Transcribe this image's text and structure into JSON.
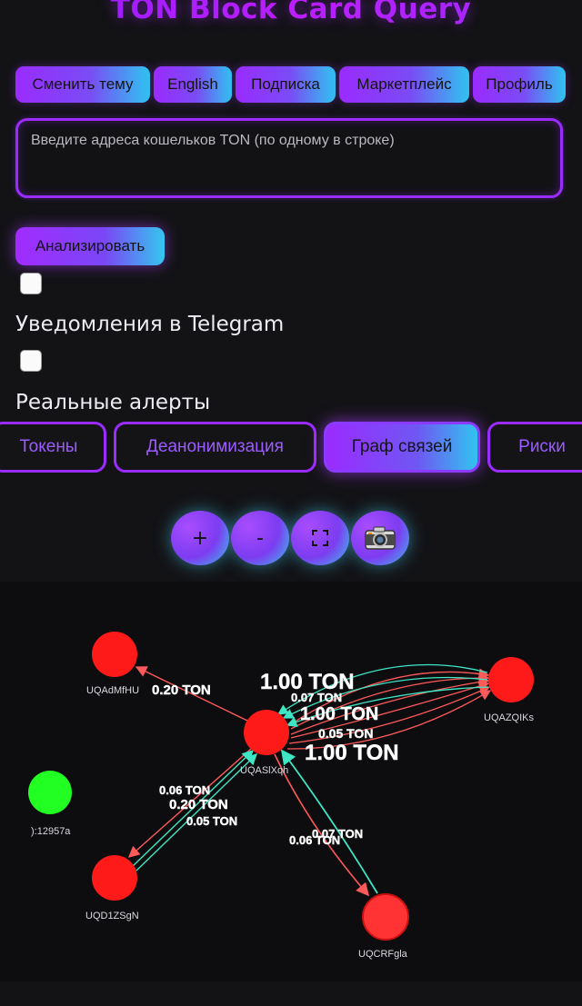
{
  "header": {
    "title": "TON Block Card Query"
  },
  "nav": [
    {
      "label": "Сменить тему"
    },
    {
      "label": "English"
    },
    {
      "label": "Подписка"
    },
    {
      "label": "Маркетплейс"
    },
    {
      "label": "Профиль"
    }
  ],
  "input": {
    "placeholder": "Введите адреса кошельков TON (по одному в строке)",
    "value": ""
  },
  "analyze_label": "Анализировать",
  "options": [
    {
      "label": "Уведомления в Telegram",
      "checked": false
    },
    {
      "label": "Реальные алерты",
      "checked": false
    }
  ],
  "tabs": [
    {
      "label": "Токены",
      "active": false
    },
    {
      "label": "Деанонимизация",
      "active": false
    },
    {
      "label": "Граф связей",
      "active": true
    },
    {
      "label": "Риски",
      "active": false
    }
  ],
  "controls": {
    "zoom_in": "+",
    "zoom_out": "-",
    "fit_icon": "fullscreen-icon",
    "screenshot_icon": "camera-icon"
  },
  "graph": {
    "nodes": [
      {
        "id": "UQAdMfHU",
        "label": "UQAdMfHU",
        "color": "#ff1a1a"
      },
      {
        "id": "UQASlXqh",
        "label": "UQASlXqh",
        "color": "#ff1a1a"
      },
      {
        "id": "UQAZQIKs",
        "label": "UQAZQIKs",
        "color": "#ff1a1a"
      },
      {
        "id": "x12957a",
        "label": "):12957a",
        "color": "#22ff22"
      },
      {
        "id": "UQD1ZSgN",
        "label": "UQD1ZSgN",
        "color": "#ff1a1a"
      },
      {
        "id": "UQCRFgla",
        "label": "UQCRFgla",
        "color": "#ff3333"
      }
    ],
    "edge_labels": [
      {
        "text": "0.20 TON"
      },
      {
        "text": "1.00 TON"
      },
      {
        "text": "0.06 TON"
      },
      {
        "text": "0.20 TON"
      },
      {
        "text": "0.05 TON"
      },
      {
        "text": "0.07 TON"
      },
      {
        "text": "0.06 TON"
      }
    ],
    "edge_colors": {
      "outgoing": "#ff5a5a",
      "incoming": "#3fe6c4"
    }
  }
}
